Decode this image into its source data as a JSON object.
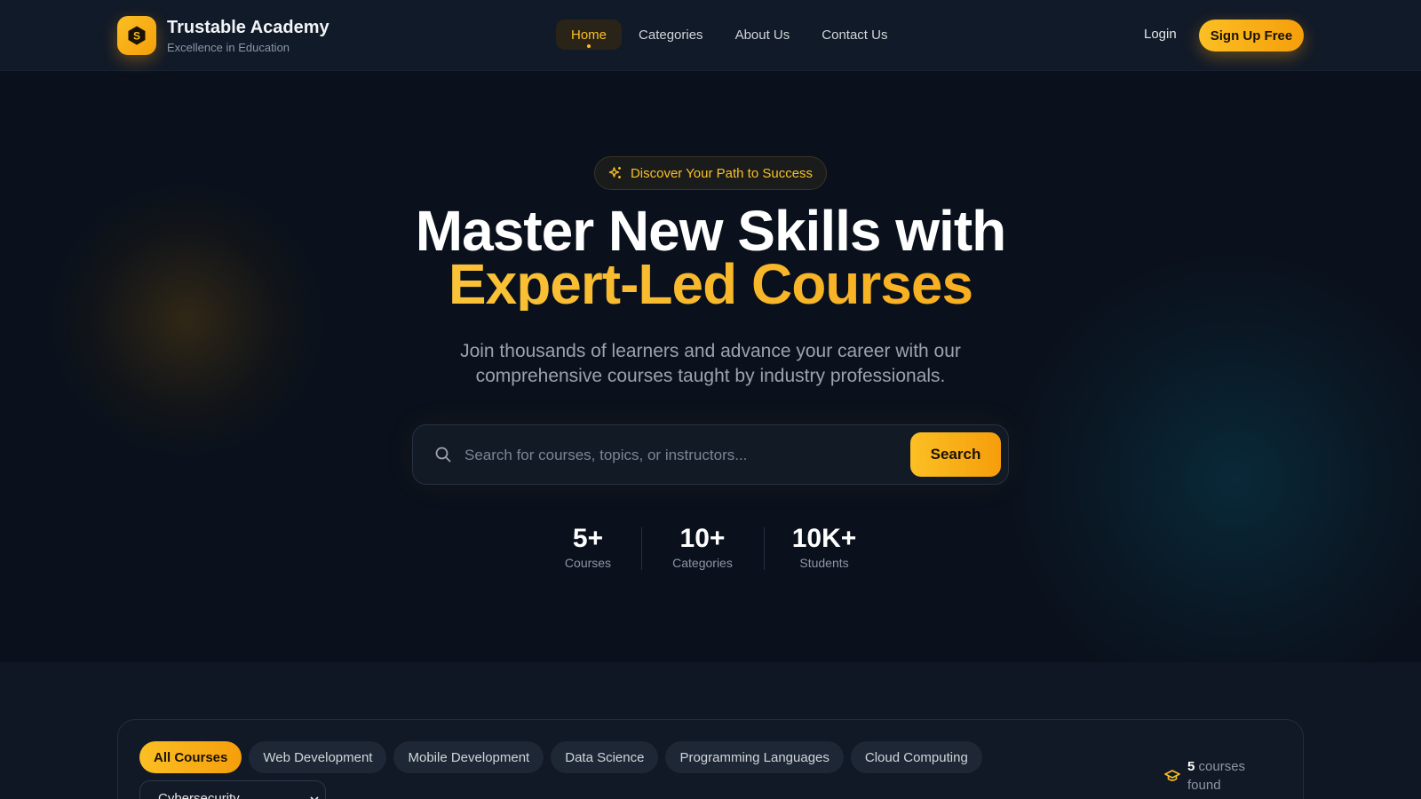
{
  "brand": {
    "title": "Trustable Academy",
    "subtitle": "Excellence in Education",
    "logo_letter": "S"
  },
  "nav": {
    "items": [
      {
        "label": "Home",
        "active": true
      },
      {
        "label": "Categories",
        "active": false
      },
      {
        "label": "About Us",
        "active": false
      },
      {
        "label": "Contact Us",
        "active": false
      }
    ],
    "login_label": "Login",
    "signup_label": "Sign Up Free"
  },
  "hero": {
    "pill_text": "Discover Your Path to Success",
    "headline_line1": "Master New Skills with",
    "headline_line2": "Expert-Led Courses",
    "subtitle": "Join thousands of learners and advance your career with our comprehensive courses taught by industry professionals.",
    "search_placeholder": "Search for courses, topics, or instructors...",
    "search_button": "Search",
    "stats": [
      {
        "value": "5+",
        "label": "Courses"
      },
      {
        "value": "10+",
        "label": "Categories"
      },
      {
        "value": "10K+",
        "label": "Students"
      }
    ]
  },
  "filters": {
    "chips": [
      {
        "label": "All Courses",
        "active": true
      },
      {
        "label": "Web Development",
        "active": false
      },
      {
        "label": "Mobile Development",
        "active": false
      },
      {
        "label": "Data Science",
        "active": false
      },
      {
        "label": "Programming Languages",
        "active": false
      },
      {
        "label": "Cloud Computing",
        "active": false
      }
    ],
    "selected_category": "Cybersecurity",
    "results_count": "5",
    "results_label": "courses found"
  },
  "icons": {
    "logo": "hexagon-s-icon",
    "pill": "sparkles-icon",
    "search": "search-icon",
    "select": "chevron-down-icon",
    "results": "graduation-cap-icon"
  },
  "colors": {
    "accent": "#fbbf24",
    "accent_dark": "#f59e0b",
    "background": "#0f1624",
    "hero_background": "#0a111c"
  }
}
